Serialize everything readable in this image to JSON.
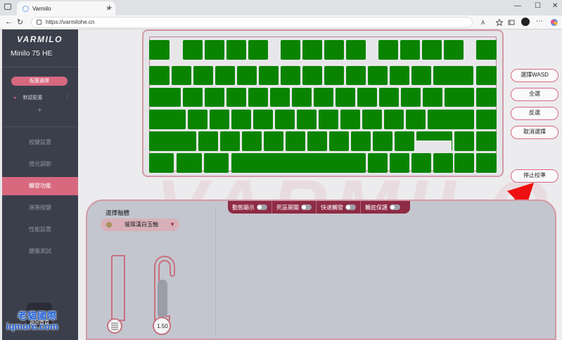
{
  "browser": {
    "tab_title": "Varmilo",
    "url": "https://varmilohe.cn",
    "new_tab_symbol": "+",
    "tab_close_symbol": "✕"
  },
  "sidebar": {
    "brand": "VARMILO",
    "model": "Minilo 75 HE",
    "profile_section": "配置選擇",
    "profile_item": "默認配置",
    "profile_add": "+",
    "menu": [
      {
        "label": "按鍵設置",
        "active": false
      },
      {
        "label": "燈光調節",
        "active": false
      },
      {
        "label": "觸發功能",
        "active": true
      },
      {
        "label": "進階按鍵",
        "active": false
      },
      {
        "label": "性能設置",
        "active": false
      },
      {
        "label": "鍵盤測試",
        "active": false
      }
    ],
    "back_label": "返回首頁"
  },
  "keyboard": {
    "key_color": "#0a8400",
    "selected_keys": "all"
  },
  "side_actions": {
    "select_wasd": "選擇WASD",
    "select_all": "全選",
    "invert": "反選",
    "cancel_select": "取消選擇",
    "stop_calibration": "停止校準"
  },
  "toggles": [
    {
      "label": "動態顯示",
      "on": false
    },
    {
      "label": "死區開關",
      "on": false
    },
    {
      "label": "快速觸發",
      "on": false
    },
    {
      "label": "觸底保護",
      "on": false
    }
  ],
  "switch_select": {
    "label": "選擇軸體",
    "value": "璀璨漢白玉軸"
  },
  "travel": {
    "value_label": "1.50",
    "slider_icon": "grip-icon"
  },
  "watermark_badge": {
    "cn": "老貓國際",
    "en": "iqmore.com"
  },
  "colors": {
    "accent": "#d7687e",
    "sidebar_bg": "#3b3f4c",
    "toggle_bar": "#8e2b45",
    "arrow": "#ee1111"
  }
}
